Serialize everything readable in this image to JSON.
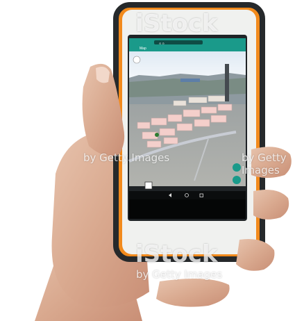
{
  "watermark": {
    "brand": "iStock",
    "byline": "by Getty Images"
  },
  "phone": {
    "case_color": "#f28a1c",
    "bezel_color": "#1f2326",
    "screen": {
      "app_bar_color": "#1a9a8a",
      "app_title": "Map",
      "status_text": "⊙ ⊙",
      "icons": [
        "menu-icon",
        "compass-icon",
        "layers-icon",
        "navigation-button-icon",
        "location-button-icon",
        "map-thumbnail-icon"
      ],
      "nav_bar": [
        "back-icon",
        "home-icon",
        "recents-icon"
      ]
    }
  }
}
